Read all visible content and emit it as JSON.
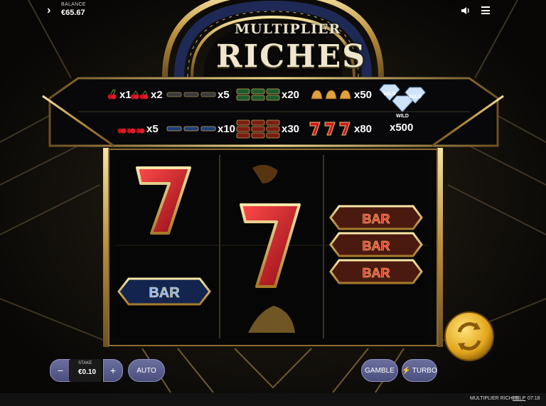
{
  "balance": {
    "label": "BALANCE",
    "value": "€65.67"
  },
  "game_title": {
    "line1": "MULTIPLIER",
    "line2": "RICHES"
  },
  "paytable": {
    "row1": [
      {
        "symbols": "cherry",
        "count": 1,
        "multiplier": "x1"
      },
      {
        "symbols": "cherry",
        "count": 2,
        "multiplier": "x2"
      },
      {
        "symbols": "any-bar",
        "count": 3,
        "multiplier": "x5"
      },
      {
        "symbols": "green-bar",
        "count": 3,
        "multiplier": "x20"
      },
      {
        "symbols": "bell",
        "count": 3,
        "multiplier": "x50"
      }
    ],
    "row2": [
      {
        "symbols": "cherry",
        "count": 3,
        "multiplier": "x5"
      },
      {
        "symbols": "blue-bar",
        "count": 3,
        "multiplier": "x10"
      },
      {
        "symbols": "red-bar",
        "count": 3,
        "multiplier": "x30"
      },
      {
        "symbols": "seven",
        "count": 3,
        "multiplier": "x80"
      }
    ],
    "wild": {
      "label": "WILD",
      "multiplier": "x500"
    }
  },
  "reels": {
    "bar_label": "BAR"
  },
  "controls": {
    "minus": "−",
    "plus": "+",
    "stake_label": "STAKE",
    "stake_value": "€0.10",
    "auto": "AUTO",
    "gamble": "GAMBLE",
    "turbo": "TURBO"
  },
  "footer": {
    "title": "MULTIPLIER RICHES",
    "help": "HELP",
    "time": "07:18"
  },
  "icons": [
    "chevron-right-icon",
    "sound-icon",
    "menu-icon",
    "spin-icon",
    "lightning-icon"
  ]
}
